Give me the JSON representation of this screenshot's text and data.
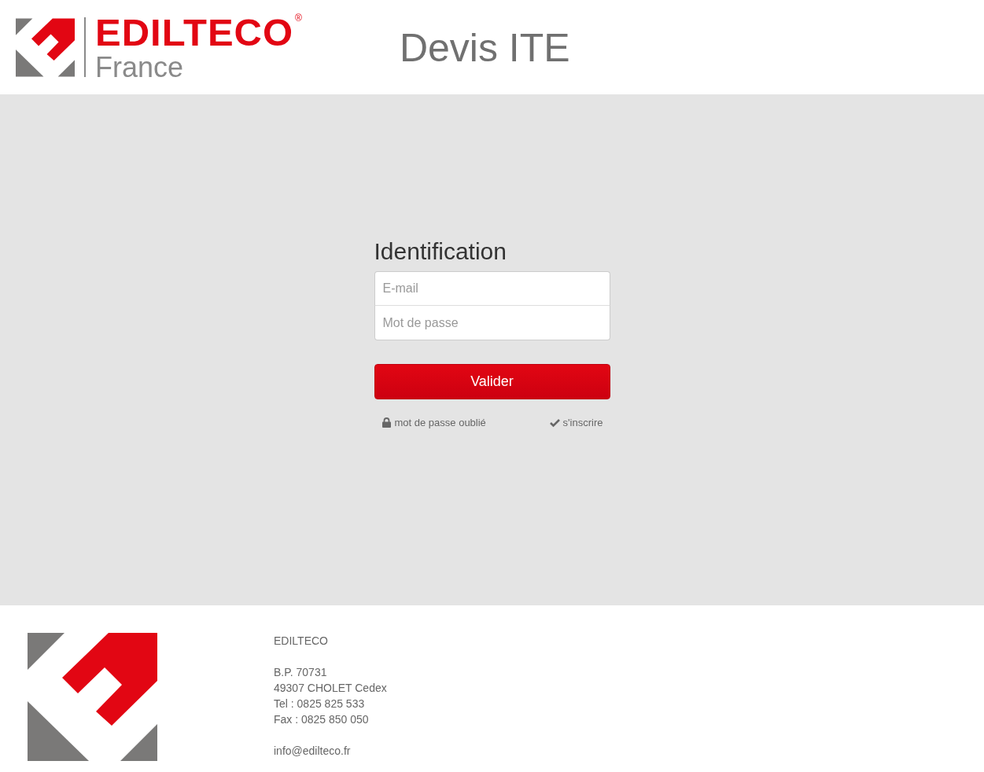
{
  "header": {
    "brand": "EDILTECO",
    "registered": "®",
    "subtitle": "France",
    "title": "Devis ITE"
  },
  "login": {
    "heading": "Identification",
    "fields": [
      {
        "placeholder": "E-mail"
      },
      {
        "placeholder": "Mot de passe"
      }
    ],
    "submit": "Valider",
    "links": [
      {
        "label": "mot de passe oublié",
        "kind": "lock"
      },
      {
        "label": "s'inscrire",
        "kind": "check"
      }
    ]
  },
  "footer": {
    "blocks": [
      [
        "EDILTECO"
      ],
      [
        "B.P. 70731",
        "49307 CHOLET Cedex",
        "Tel : 0825 825 533",
        "Fax : 0825 850 050"
      ],
      [
        "info@edilteco.fr"
      ]
    ]
  }
}
